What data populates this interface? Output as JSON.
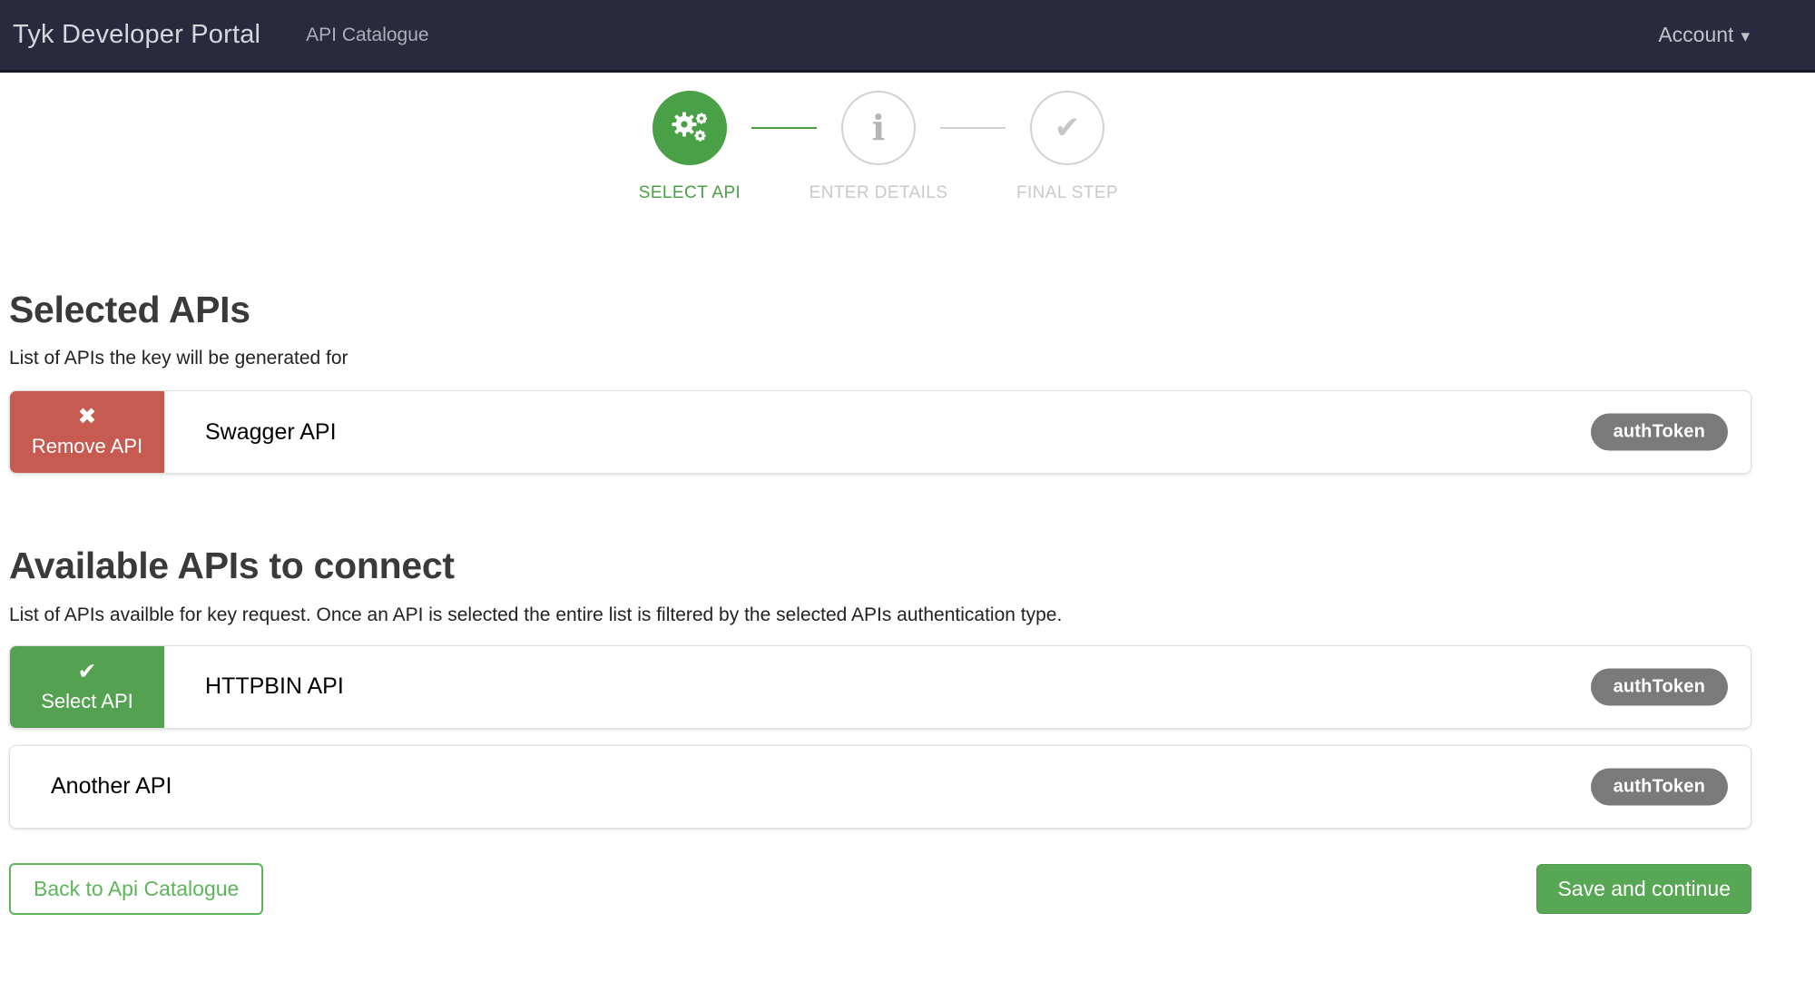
{
  "navbar": {
    "brand": "Tyk Developer Portal",
    "catalogue_link": "API Catalogue",
    "account_label": "Account"
  },
  "stepper": {
    "steps": [
      {
        "label": "SELECT API",
        "icon": "cogs-icon",
        "state": "active"
      },
      {
        "label": "ENTER DETAILS",
        "icon": "info-icon",
        "state": "upcoming"
      },
      {
        "label": "FINAL STEP",
        "icon": "check-icon",
        "state": "upcoming"
      }
    ]
  },
  "selected_section": {
    "heading": "Selected APIs",
    "subtitle": "List of APIs the key will be generated for",
    "apis": [
      {
        "name": "Swagger API",
        "auth_type": "authToken",
        "action": "Remove API"
      }
    ]
  },
  "available_section": {
    "heading": "Available APIs to connect",
    "subtitle": "List of APIs availble for key request. Once an API is selected the entire list is filtered by the selected APIs authentication type.",
    "apis": [
      {
        "name": "HTTPBIN API",
        "auth_type": "authToken",
        "action": "Select API"
      },
      {
        "name": "Another API",
        "auth_type": "authToken"
      }
    ]
  },
  "footer": {
    "back_button": "Back to Api Catalogue",
    "save_button": "Save and continue"
  },
  "icons": {
    "remove": "✖",
    "select_check": "✔",
    "final_check": "✔",
    "info": "i",
    "account_caret": "▾"
  },
  "colors": {
    "navbar_bg": "#2a2a3e",
    "stepper_green": "#4aa046",
    "button_green": "#54a251",
    "remove_red": "#c75b51",
    "badge_gray": "#7a7a7a",
    "inactive_gray": "#c9c9c9"
  }
}
